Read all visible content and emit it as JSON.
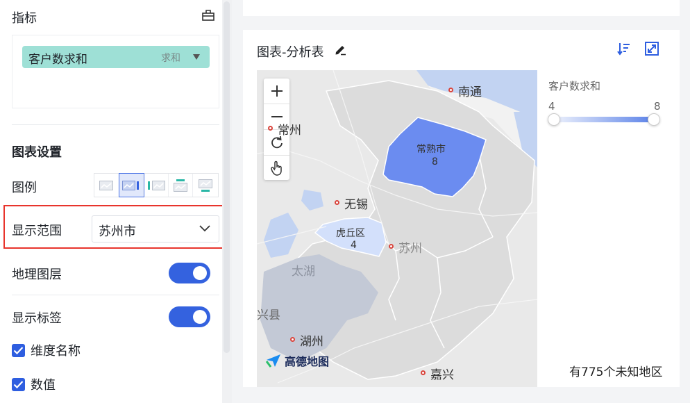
{
  "sidebar": {
    "metric_section_title": "指标",
    "metric_field": {
      "label": "客户数求和",
      "aggregation": "求和"
    },
    "chart_settings_title": "图表设置",
    "legend_label": "图例",
    "display_range": {
      "label": "显示范围",
      "value": "苏州市"
    },
    "geo_layer": {
      "label": "地理图层",
      "enabled": true
    },
    "show_labels": {
      "label": "显示标签",
      "enabled": true
    },
    "checkboxes": [
      {
        "label": "维度名称",
        "checked": true
      },
      {
        "label": "数值",
        "checked": true
      }
    ]
  },
  "chart": {
    "title": "图表-分析表",
    "map": {
      "cities": [
        "南通",
        "常州",
        "无锡",
        "苏州",
        "湖州",
        "嘉兴"
      ],
      "lake": "太湖",
      "partial_label": "兴县",
      "regions": [
        {
          "name": "常熟市",
          "value": "8"
        },
        {
          "name": "虎丘区",
          "value": "4"
        }
      ],
      "provider": "高德地图"
    },
    "legend": {
      "title": "客户数求和",
      "min": "4",
      "max": "8"
    },
    "unknown_regions_note": "有775个未知地区"
  },
  "colors": {
    "accent": "#3462df",
    "highlight_region": "#6b8cf0",
    "light_region": "#d3e0fb",
    "highlight_box": "#e8342c",
    "metric_pill": "#9ee0d6"
  }
}
